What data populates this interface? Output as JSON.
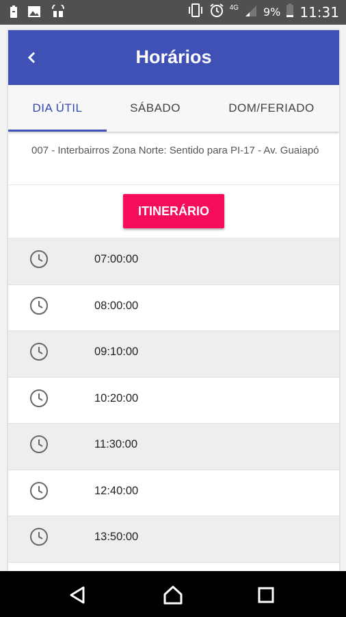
{
  "status_bar": {
    "battery_percent": "9%",
    "time": "11:31",
    "network": "4G"
  },
  "app_bar": {
    "title": "Horários"
  },
  "tabs": [
    {
      "label": "DIA ÚTIL",
      "selected": true
    },
    {
      "label": "SÁBADO",
      "selected": false
    },
    {
      "label": "DOM/FERIADO",
      "selected": false
    }
  ],
  "route": {
    "description": "007 - Interbairros Zona Norte: Sentido para PI-17 - Av. Guaiapó"
  },
  "itinerary_button": {
    "label": "ITINERÁRIO"
  },
  "times": [
    "07:00:00",
    "08:00:00",
    "09:10:00",
    "10:20:00",
    "11:30:00",
    "12:40:00",
    "13:50:00"
  ],
  "colors": {
    "primary": "#3f51b5",
    "accent": "#f50c5a",
    "row_alt": "#eeeeee"
  }
}
